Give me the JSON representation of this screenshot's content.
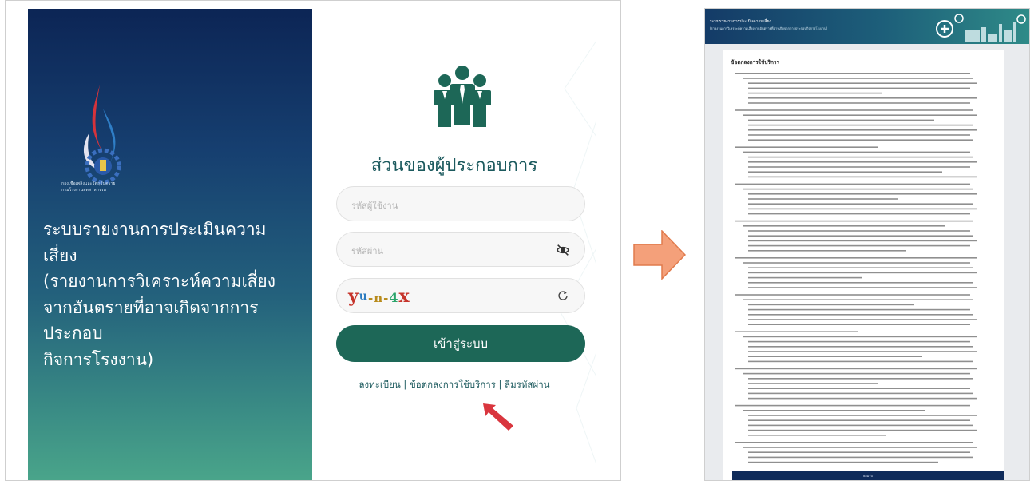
{
  "login": {
    "agency_name_line1": "กองเชื้อเพลิงและวัตถุอันตราย",
    "agency_name_line2": "กรมโรงงานอุตสาหกรรม",
    "system_title_lines": [
      "ระบบรายงานการประเมินความ",
      "เสี่ยง",
      "(รายงานการวิเคราะห์ความเสี่ยง",
      "จากอันตรายที่อาจเกิดจากการ",
      "ประกอบ",
      "กิจการโรงงาน)"
    ],
    "portal_title": "ส่วนของผู้ประกอบการ",
    "username_placeholder": "รหัสผู้ใช้งาน",
    "password_placeholder": "รหัสผ่าน",
    "captcha_text": "yu4x",
    "login_button": "เข้าสู่ระบบ",
    "links": {
      "register": "ลงทะเบียน",
      "terms": "ข้อตกลงการใช้บริการ",
      "forgot_password": "ลืมรหัสผ่าน",
      "separator": " | "
    }
  },
  "terms_page": {
    "header_title": "ระบบรายงานการประเมินความเสี่ยง",
    "header_subtitle": "(รายงานการวิเคราะห์ความเสี่ยงจากอันตรายที่อาจเกิดจากการประกอบกิจการโรงงาน)",
    "heading": "ข้อตกลงการใช้บริการ",
    "accept_label": "ยอมรับ"
  },
  "colors": {
    "primary_green": "#1d6757",
    "title_teal": "#1c5a5e",
    "panel_navy": "#0c2555",
    "arrow_orange": "#f08a5d",
    "pointer_red": "#d9363e"
  }
}
